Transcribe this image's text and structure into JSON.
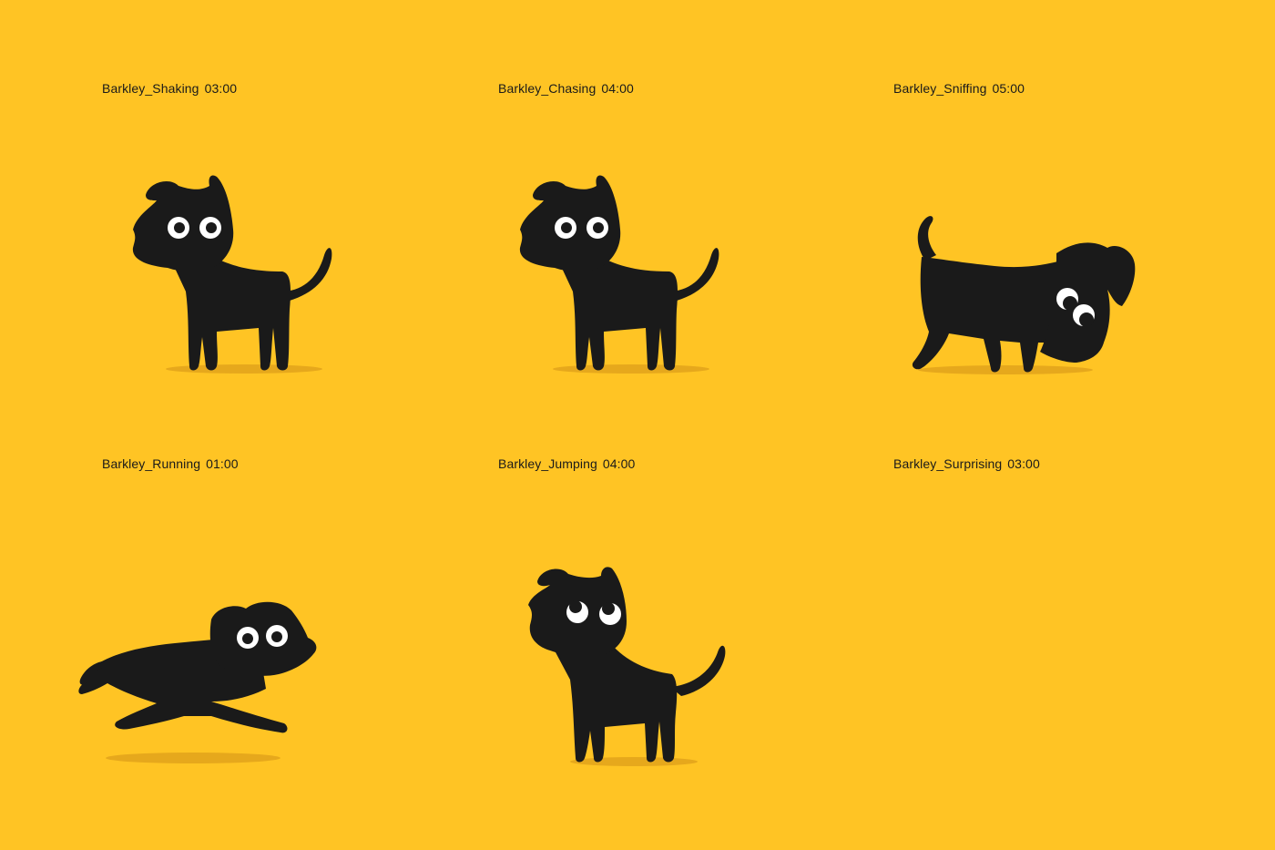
{
  "colors": {
    "background": "#FFC424",
    "dog": "#1A1A1A",
    "shadow": "#E6A81C",
    "eye": "#FFFFFF"
  },
  "animations": [
    {
      "name": "Barkley_Shaking",
      "duration": "03:00",
      "pose": "standing"
    },
    {
      "name": "Barkley_Chasing",
      "duration": "04:00",
      "pose": "standing"
    },
    {
      "name": "Barkley_Sniffing",
      "duration": "05:00",
      "pose": "sniffing"
    },
    {
      "name": "Barkley_Running",
      "duration": "01:00",
      "pose": "running"
    },
    {
      "name": "Barkley_Jumping",
      "duration": "04:00",
      "pose": "jumping"
    },
    {
      "name": "Barkley_Surprising",
      "duration": "03:00",
      "pose": "empty"
    }
  ]
}
